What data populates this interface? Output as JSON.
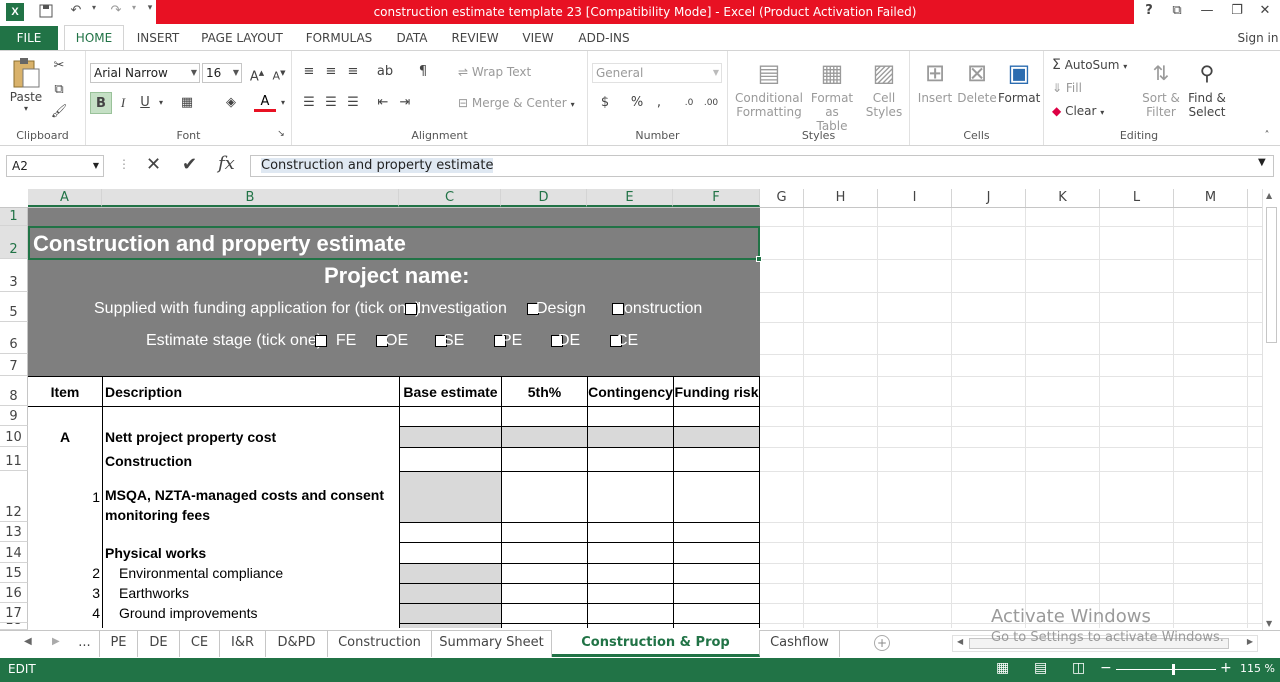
{
  "window": {
    "title": "construction estimate template 23  [Compatibility Mode] -  Excel (Product Activation Failed)",
    "help": "?",
    "signin": "Sign in"
  },
  "ribbon": {
    "file": "FILE",
    "tabs": [
      "HOME",
      "INSERT",
      "PAGE LAYOUT",
      "FORMULAS",
      "DATA",
      "REVIEW",
      "VIEW",
      "ADD-INS"
    ],
    "clipboard": {
      "paste": "Paste",
      "label": "Clipboard"
    },
    "font": {
      "name": "Arial Narrow",
      "size": "16",
      "label": "Font",
      "bold": "B",
      "italic": "I",
      "underline": "U"
    },
    "alignment": {
      "wrap": "Wrap Text",
      "merge": "Merge & Center",
      "label": "Alignment"
    },
    "number": {
      "format": "General",
      "percent": "%",
      "comma": ",",
      "label": "Number"
    },
    "styles": {
      "conditional": "Conditional",
      "conditional2": "Formatting",
      "format_as": "Format as",
      "format_as2": "Table",
      "cell": "Cell",
      "cell2": "Styles",
      "label": "Styles"
    },
    "cells": {
      "insert": "Insert",
      "delete": "Delete",
      "format": "Format",
      "label": "Cells"
    },
    "editing": {
      "autosum": "AutoSum",
      "fill": "Fill",
      "clear": "Clear",
      "sort": "Sort &",
      "sort2": "Filter",
      "find": "Find &",
      "find2": "Select",
      "label": "Editing"
    }
  },
  "formula_bar": {
    "name_box": "A2",
    "fx": "fx",
    "content": "Construction and property estimate"
  },
  "columns": [
    "A",
    "B",
    "C",
    "D",
    "E",
    "F",
    "G",
    "H",
    "I",
    "J",
    "K",
    "L",
    "M"
  ],
  "rows": [
    "1",
    "2",
    "3",
    "5",
    "6",
    "7",
    "8",
    "9",
    "10",
    "11",
    "12",
    "13",
    "14",
    "15",
    "16",
    "17",
    "18"
  ],
  "sheet": {
    "title": "Construction and property estimate",
    "project": "Project name:",
    "funding_label": "Supplied with funding application for (tick one):",
    "funding_options": [
      "Investigation",
      "Design",
      "onstruction"
    ],
    "stage_label": "Estimate stage (tick one)",
    "stage_options": [
      "FE",
      "OE",
      "SE",
      "PE",
      "DE",
      "CE"
    ],
    "headers": {
      "item": "Item",
      "description": "Description",
      "base": "Base estimate",
      "p5": "5th%",
      "contingency": "Contingency",
      "funding_risk": "Funding risk"
    },
    "rows": [
      {
        "item": "A",
        "desc": "Nett project property cost"
      },
      {
        "item": "",
        "desc": "Construction"
      },
      {
        "item": "1",
        "desc": "MSQA, NZTA-managed costs and consent",
        "desc2": "monitoring fees"
      },
      {
        "item": "",
        "desc": "Physical works"
      },
      {
        "item": "2",
        "desc": "Environmental compliance"
      },
      {
        "item": "3",
        "desc": "Earthworks"
      },
      {
        "item": "4",
        "desc": "Ground improvements"
      }
    ]
  },
  "watermark": {
    "line1": "Activate Windows",
    "line2": "Go to Settings to activate Windows."
  },
  "sheet_tabs": [
    "...",
    "PE",
    "DE",
    "CE",
    "I&R",
    "D&PD",
    "Construction",
    "Summary Sheet",
    "Construction & Prop Estimate",
    "Cashflow"
  ],
  "status": {
    "mode": "EDIT",
    "zoom": "115 %"
  },
  "colors": {
    "excel_green": "#217346",
    "title_red": "#e81123",
    "band_gray": "#7f7f7f",
    "shade": "#d9d9d9"
  }
}
